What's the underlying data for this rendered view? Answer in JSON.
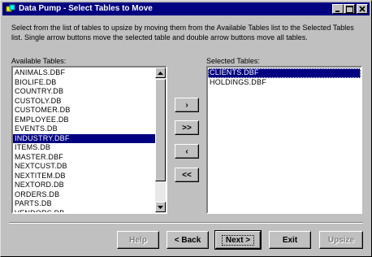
{
  "window": {
    "title": "Data Pump - Select Tables to Move"
  },
  "description": "Select from the list of tables to upsize by moving them from the Available Tables list to the Selected Tables list. Single arrow buttons move the selected table and double arrow buttons move all tables.",
  "available": {
    "label": "Available Tables:",
    "items": [
      "ANIMALS.DBF",
      "BIOLIFE.DB",
      "COUNTRY.DB",
      "CUSTOLY.DB",
      "CUSTOMER.DB",
      "EMPLOYEE.DB",
      "EVENTS.DB",
      "INDUSTRY.DBF",
      "ITEMS.DB",
      "MASTER.DBF",
      "NEXTCUST.DB",
      "NEXTITEM.DB",
      "NEXTORD.DB",
      "ORDERS.DB",
      "PARTS.DB",
      "VENDORS.DB"
    ],
    "selected_index": 7
  },
  "selected": {
    "label": "Selected Tables:",
    "items": [
      "CLIENTS.DBF",
      "HOLDINGS.DBF"
    ],
    "selected_index": 0
  },
  "move_buttons": {
    "add_one": "›",
    "add_all": ">>",
    "remove_one": "‹",
    "remove_all": "<<"
  },
  "footer": {
    "help": "Help",
    "back": "< Back",
    "next": "Next >",
    "exit": "Exit",
    "upsize": "Upsize"
  }
}
